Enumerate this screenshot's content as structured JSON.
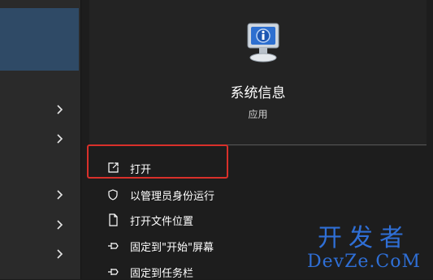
{
  "app": {
    "title": "系统信息",
    "type": "应用",
    "icon": "system-info-icon"
  },
  "actions": [
    {
      "label": "打开",
      "icon": "open-icon"
    },
    {
      "label": "以管理员身份运行",
      "icon": "shield-icon"
    },
    {
      "label": "打开文件位置",
      "icon": "file-location-icon"
    },
    {
      "label": "固定到\"开始\"屏幕",
      "icon": "pin-icon"
    },
    {
      "label": "固定到任务栏",
      "icon": "pin-icon"
    }
  ],
  "left_results": {
    "chevron_count": 5
  },
  "watermark": {
    "cn": "开发者",
    "en": "DevZe.CoM"
  },
  "colors": {
    "highlight": "#d9302a",
    "watermark": "#2f6fd6",
    "selected": "#2f4a66"
  }
}
